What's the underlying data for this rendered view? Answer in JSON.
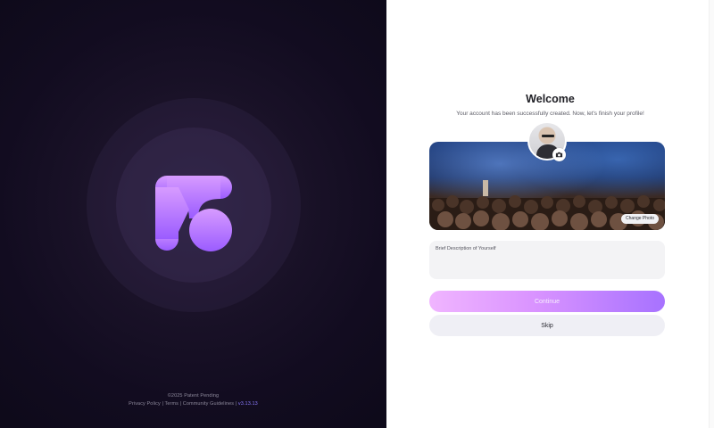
{
  "brand": {
    "logo_icon": "app-logo-icon",
    "gradient_top": "#d79bff",
    "gradient_bottom": "#9b5cff"
  },
  "footer": {
    "copyright": "©2025 Patent Pending",
    "links": [
      "Privacy Policy",
      "Terms",
      "Community Guidelines"
    ],
    "separator": " | ",
    "version": "v3.13.13"
  },
  "welcome": {
    "title": "Welcome",
    "subtitle": "Your account has been successfully created. Now, let's finish your profile!"
  },
  "profile": {
    "change_photo_label": "Change Photo",
    "camera_icon": "camera-icon",
    "description_placeholder": "Brief Description of Yourself"
  },
  "actions": {
    "continue_label": "Continue",
    "skip_label": "Skip"
  },
  "colors": {
    "accent": "#a772ff",
    "left_bg": "#120c20"
  }
}
